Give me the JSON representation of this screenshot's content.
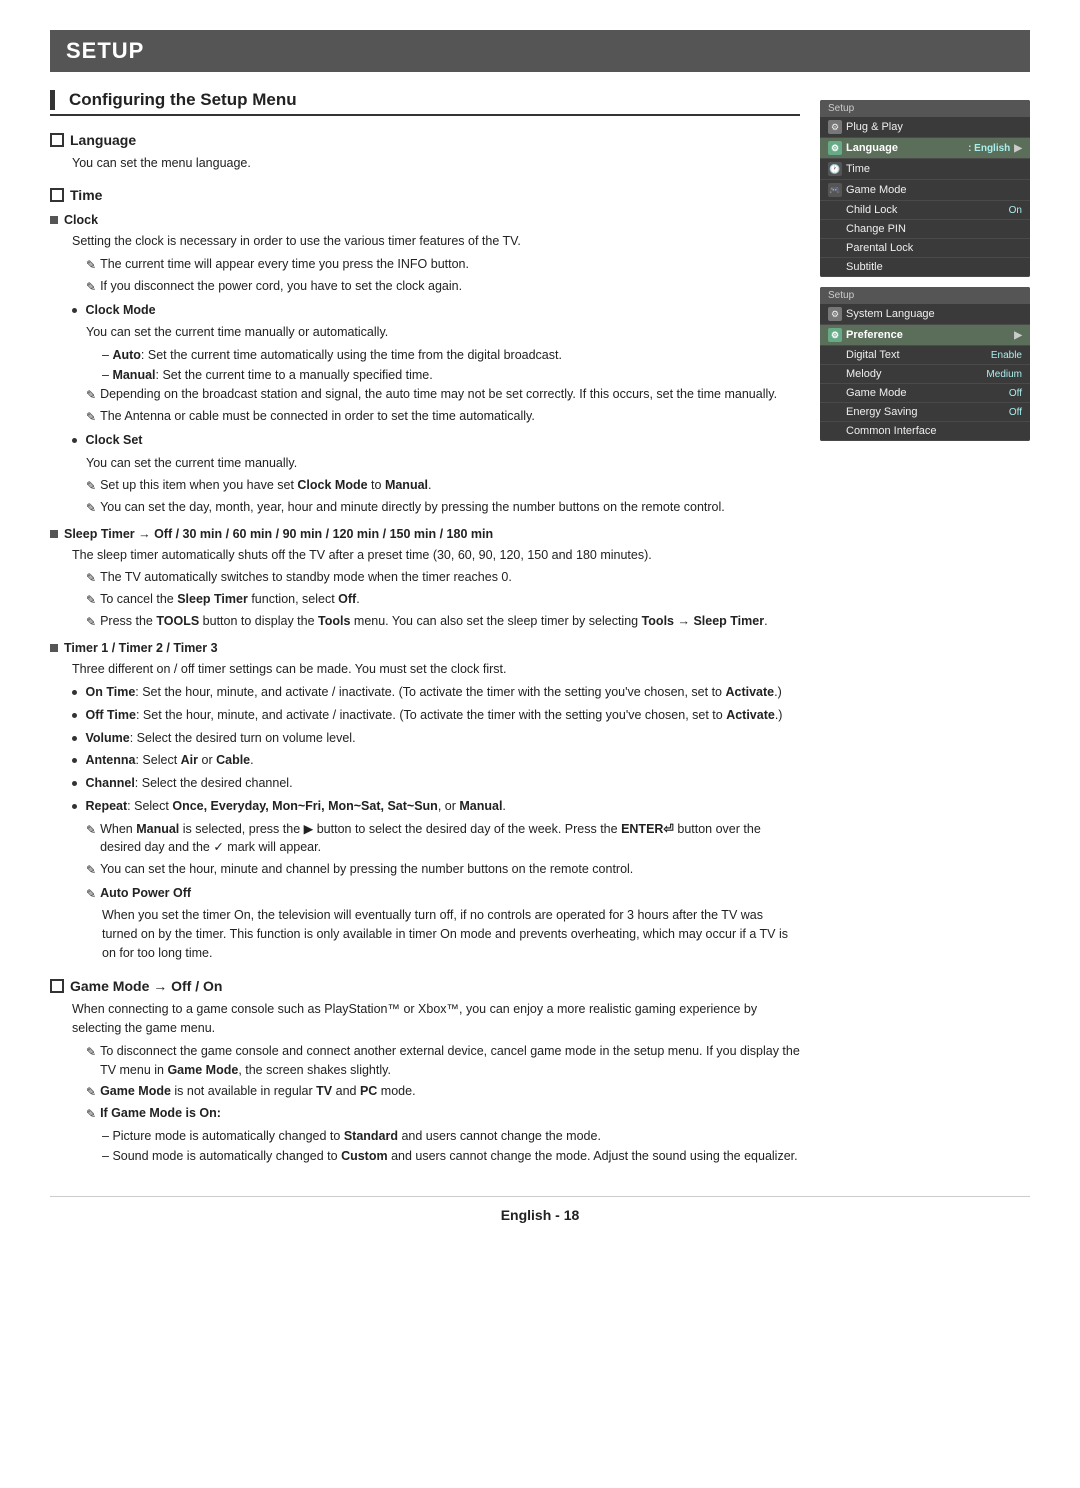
{
  "header": {
    "title": "SETUP"
  },
  "section": {
    "title": "Configuring the Setup Menu"
  },
  "language": {
    "label": "Language",
    "description": "You can set the menu language."
  },
  "time": {
    "label": "Time",
    "clock": {
      "label": "Clock",
      "description": "Setting the clock is necessary in order to use the various timer features of the TV.",
      "note1": "The current time will appear every time you press the INFO button.",
      "note2": "If you disconnect the power cord, you have to set the clock again.",
      "clockMode": {
        "label": "Clock Mode",
        "description": "You can set the current time manually or automatically.",
        "auto": "Auto: Set the current time automatically using the time from the digital broadcast.",
        "manual": "Manual: Set the current time to a manually specified time.",
        "note1": "Depending on the broadcast station and signal, the auto time may not be set correctly. If this occurs, set the time manually.",
        "note2": "The Antenna or cable must be connected in order to set the time automatically."
      },
      "clockSet": {
        "label": "Clock Set",
        "description": "You can set the current time manually.",
        "note1": "Set up this item when you have set Clock Mode to Manual.",
        "note2": "You can set the day, month, year, hour and minute directly by pressing the number buttons on the remote control."
      }
    },
    "sleepTimer": {
      "label": "Sleep Timer → Off / 30 min / 60 min / 90 min / 120 min / 150 min / 180 min",
      "description": "The sleep timer automatically shuts off the TV after a preset time (30, 60, 90, 120, 150 and 180 minutes).",
      "note1": "The TV automatically switches to standby mode when the timer reaches 0.",
      "note2": "To cancel the Sleep Timer function, select Off.",
      "note3": "Press the TOOLS button to display the Tools menu. You can also set the sleep timer by selecting Tools → Sleep Timer."
    },
    "timer": {
      "label": "Timer 1 / Timer 2 / Timer 3",
      "description": "Three different on / off timer settings can be made. You must set the clock first.",
      "onTime": "On Time: Set the hour, minute, and activate / inactivate. (To activate the timer with the setting you've chosen, set to Activate.)",
      "offTime": "Off Time: Set the hour, minute, and activate / inactivate. (To activate the timer with the setting you've chosen, set to Activate.)",
      "volume": "Volume: Select the desired turn on volume level.",
      "antenna": "Antenna: Select Air or Cable.",
      "channel": "Channel: Select the desired channel.",
      "repeat": "Repeat: Select Once, Everyday, Mon~Fri, Mon~Sat, Sat~Sun, or Manual.",
      "note_repeat": "When Manual is selected, press the ▶ button to select the desired day of the week. Press the ENTER⏎ button over the desired day and the ✓ mark will appear.",
      "note_channel": "You can set the hour, minute and channel by pressing the number buttons on the remote control.",
      "autoPowerOff": {
        "label": "Auto Power Off",
        "description": "When you set the timer On, the television will eventually turn off, if no controls are operated for 3 hours after the TV was turned on by the timer. This function is only available in timer On mode and prevents overheating, which may occur if a TV is on for too long time."
      }
    }
  },
  "gameMode": {
    "label": "Game Mode → Off / On",
    "description": "When connecting to a game console such as PlayStation™ or Xbox™, you can enjoy a more realistic gaming experience by selecting the game menu.",
    "note1": "To disconnect the game console and connect another external device, cancel game mode in the setup menu. If you display the TV menu in Game Mode, the screen shakes slightly.",
    "note2": "Game Mode is not available in regular TV and PC mode.",
    "note3": "If Game Mode is On:",
    "if1": "Picture mode is automatically changed to Standard and users cannot change the mode.",
    "if2": "Sound mode is automatically changed to Custom and users cannot change the mode. Adjust the sound using the equalizer."
  },
  "sidebar": {
    "panel1": {
      "header": "Setup",
      "rows": [
        {
          "label": "Plug & Play",
          "value": "",
          "icon": "gear"
        },
        {
          "label": "Language",
          "value": ": English",
          "arrow": "▶",
          "highlighted": true
        },
        {
          "label": "Time",
          "value": "",
          "icon": "clock"
        },
        {
          "label": "Game Mode",
          "value": "",
          "icon": "game"
        },
        {
          "label": "Child Lock",
          "value": "On"
        },
        {
          "label": "Change PIN",
          "value": ""
        },
        {
          "label": "Parental Lock",
          "value": ""
        },
        {
          "label": "Subtitle",
          "value": ""
        }
      ]
    },
    "panel2": {
      "header": "Setup",
      "rows": [
        {
          "label": "System Language",
          "value": ""
        },
        {
          "label": "Preference",
          "value": "",
          "arrow": "▶",
          "highlighted": true
        },
        {
          "label": "Digital Text",
          "value": "Enable"
        },
        {
          "label": "Melody",
          "value": "Medium"
        },
        {
          "label": "Game Mode",
          "value": "Off"
        },
        {
          "label": "Energy Saving",
          "value": "Off"
        },
        {
          "label": "Common Interface",
          "value": ""
        }
      ]
    }
  },
  "footer": {
    "text": "English - 18"
  }
}
